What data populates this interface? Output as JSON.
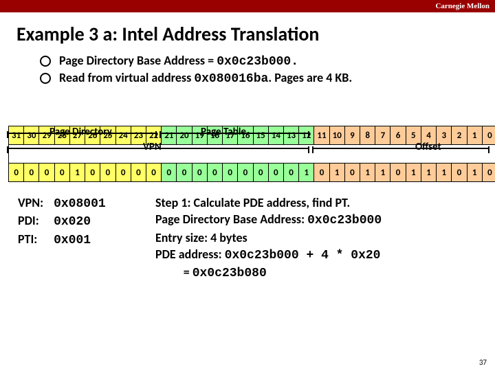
{
  "header": {
    "org": "Carnegie Mellon"
  },
  "title": "Example 3 a: Intel Address Translation",
  "bullets": {
    "b1_pre": "Page Directory Base Address = ",
    "b1_val": "0x0c23b000.",
    "b2_pre": "Read from virtual address ",
    "b2_val": "0x080016ba",
    "b2_post": ". Pages are 4 KB."
  },
  "labels": {
    "page_dir": "Page Directory",
    "page_table": "Page Table",
    "vpn": "VPN",
    "offset": "Offset"
  },
  "bits_index": [
    "31",
    "30",
    "29",
    "28",
    "27",
    "26",
    "25",
    "24",
    "23",
    "22",
    "21",
    "20",
    "19",
    "18",
    "17",
    "16",
    "15",
    "14",
    "13",
    "12",
    "11",
    "10",
    "9",
    "8",
    "7",
    "6",
    "5",
    "4",
    "3",
    "2",
    "1",
    "0"
  ],
  "bits_value": [
    "0",
    "0",
    "0",
    "0",
    "1",
    "0",
    "0",
    "0",
    "0",
    "0",
    "0",
    "0",
    "0",
    "0",
    "0",
    "0",
    "0",
    "0",
    "0",
    "1",
    "0",
    "1",
    "0",
    "1",
    "1",
    "0",
    "1",
    "1",
    "1",
    "0",
    "1",
    "0"
  ],
  "left": {
    "vpn_lab": "VPN:",
    "vpn_val": "0x08001",
    "pdi_lab": "PDI:",
    "pdi_val": "0x020",
    "pti_lab": "PTI:",
    "pti_val": "0x001"
  },
  "right": {
    "l1": "Step 1: Calculate PDE address, find PT.",
    "l2a": "Page Directory Base Address:  ",
    "l2b": "0x0c23b000",
    "l3": "Entry size: 4 bytes",
    "l4a": "PDE address:  ",
    "l4b": "0x0c23b000 + 4 * 0x20",
    "l5a": "          = ",
    "l5b": "0x0c23b080"
  },
  "pagenum": "37"
}
